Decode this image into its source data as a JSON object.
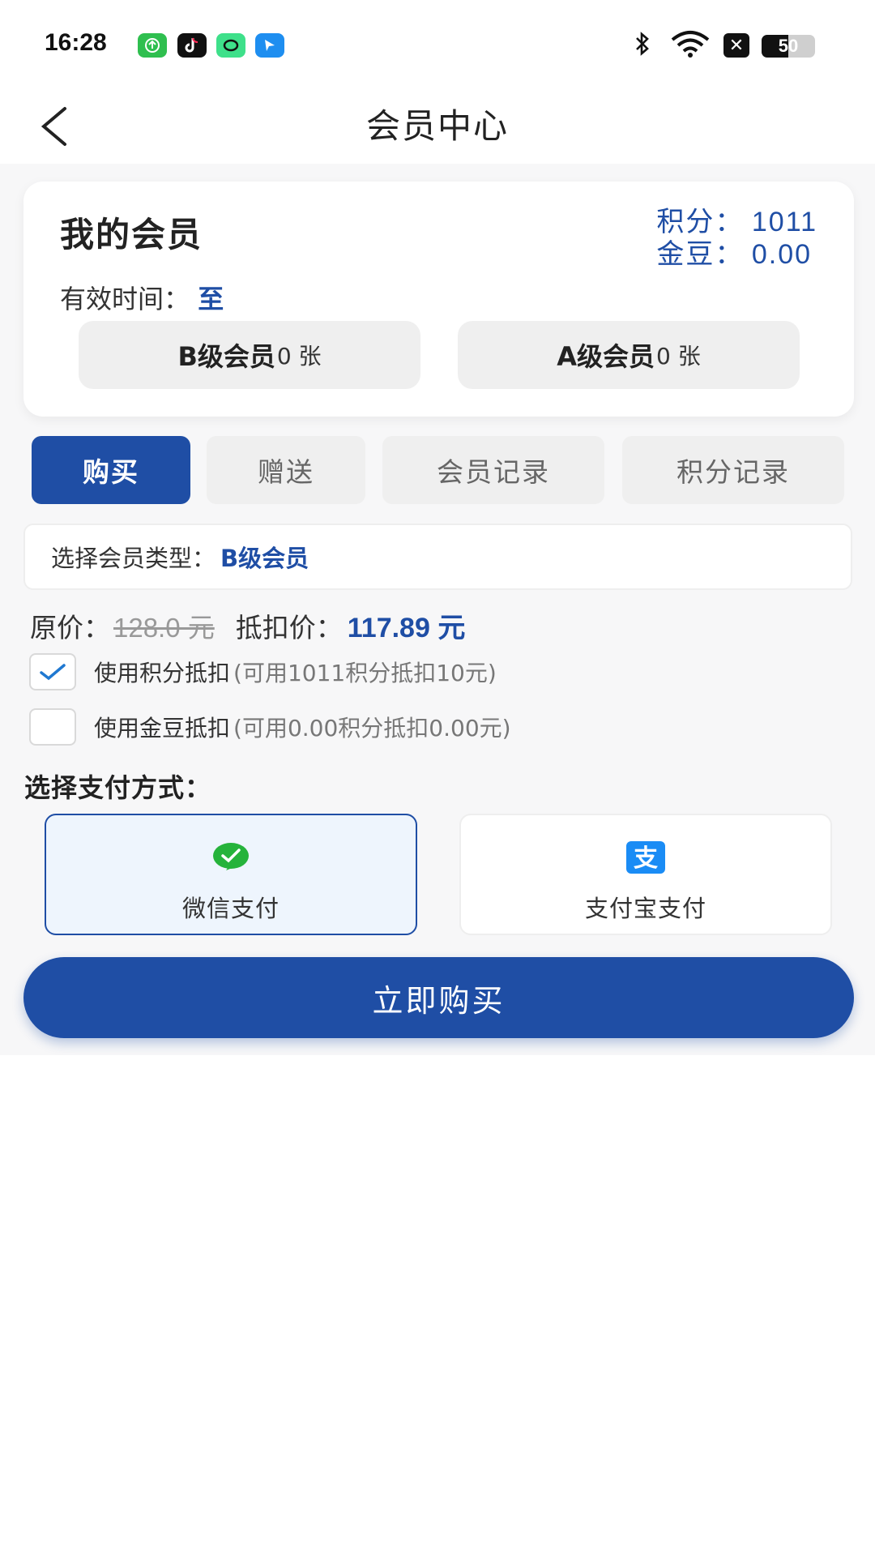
{
  "status_bar": {
    "time": "16:28",
    "battery": "50",
    "battery_level": 0.5,
    "icons": [
      "app-icon-green",
      "tiktok-icon",
      "app-icon-mint",
      "app-icon-blue",
      "bluetooth-icon",
      "wifi-icon",
      "x-icon",
      "battery-icon"
    ]
  },
  "header": {
    "title": "会员中心"
  },
  "member_card": {
    "title": "我的会员",
    "points_label": "积分：",
    "points_value": "1011",
    "beans_label": "金豆：",
    "beans_value": "0.00",
    "valid_label": "有效时间：",
    "valid_value": "至",
    "levels": [
      {
        "name": "B级会员",
        "count": "0 张"
      },
      {
        "name": "A级会员",
        "count": "0 张"
      }
    ]
  },
  "tabs": [
    {
      "label": "购买",
      "active": true
    },
    {
      "label": "赠送",
      "active": false
    },
    {
      "label": "会员记录",
      "active": false
    },
    {
      "label": "积分记录",
      "active": false
    }
  ],
  "member_type": {
    "label": "选择会员类型：",
    "value": "B级会员"
  },
  "price": {
    "orig_label": "原价：",
    "orig_value": "128.0 元",
    "disc_label": "抵扣价：",
    "disc_value": "117.89 元"
  },
  "deductions": [
    {
      "label": "使用积分抵扣",
      "hint": "(可用1011积分抵扣10元)",
      "checked": true
    },
    {
      "label": "使用金豆抵扣",
      "hint": "(可用0.00积分抵扣0.00元)",
      "checked": false
    }
  ],
  "payment": {
    "title": "选择支付方式：",
    "methods": [
      {
        "label": "微信支付",
        "selected": true,
        "icon": "wechat-pay-icon"
      },
      {
        "label": "支付宝支付",
        "selected": false,
        "icon": "alipay-icon"
      }
    ]
  },
  "buy_button": {
    "label": "立即购买"
  },
  "colors": {
    "accent": "#1f4ea5",
    "background": "#f7f7f8"
  }
}
